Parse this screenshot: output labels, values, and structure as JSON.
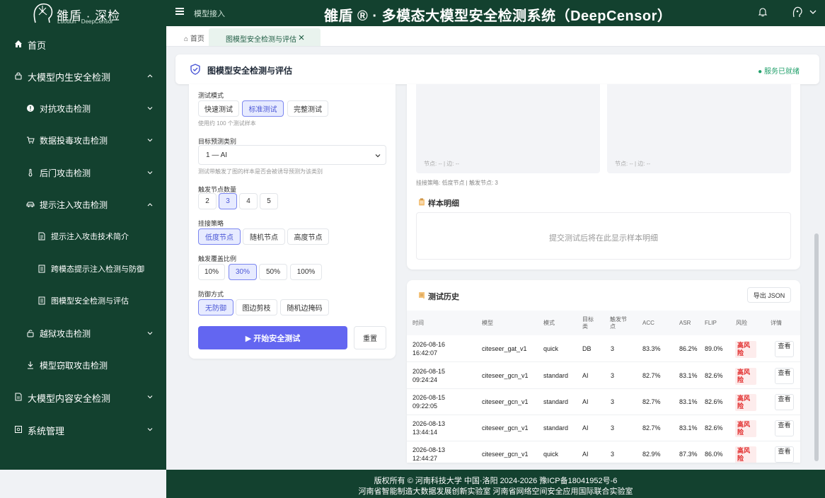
{
  "brand": {
    "name_cn": "雒盾 · 深检",
    "name_en": "Luodun · DeepCensor"
  },
  "topbar": {
    "breadcrumb": "模型接入",
    "system_title": "雒盾 ® · 多模态大模型安全检测系统（DeepCensor）"
  },
  "sidebar": {
    "items": [
      {
        "label": "首页"
      },
      {
        "label": "大模型内生安全检测"
      },
      {
        "label": "对抗攻击检测"
      },
      {
        "label": "数据投毒攻击检测"
      },
      {
        "label": "后门攻击检测"
      },
      {
        "label": "提示注入攻击检测"
      },
      {
        "label": "提示注入攻击技术简介"
      },
      {
        "label": "跨模态提示注入检测与防御"
      },
      {
        "label": "图模型安全检测与评估"
      },
      {
        "label": "越狱攻击检测"
      },
      {
        "label": "模型窃取攻击检测"
      },
      {
        "label": "大模型内容安全检测"
      },
      {
        "label": "系统管理"
      }
    ]
  },
  "tabs": {
    "home": "首页",
    "active": "图模型安全检测与评估"
  },
  "page": {
    "title": "图模型安全检测与评估",
    "status": "● 服务已就绪"
  },
  "config": {
    "mode_label": "测试模式",
    "modes": [
      "快速测试",
      "标准测试",
      "完整测试"
    ],
    "mode_hint": "使用约 100 个测试样本",
    "target_label": "目标预测类别",
    "target_value": "1 — AI",
    "target_hint": "测试带触发了图的样本是否会被诱导预测为该类别",
    "nodes_label": "触发节点数量",
    "nodes": [
      "2",
      "3",
      "4",
      "5"
    ],
    "strategy_label": "挂接策略",
    "strategies": [
      "低度节点",
      "随机节点",
      "高度节点"
    ],
    "coverage_label": "触发覆盖比例",
    "coverages": [
      "10%",
      "30%",
      "50%",
      "100%"
    ],
    "defense_label": "防御方式",
    "defenses": [
      "无防御",
      "图边剪枝",
      "随机边掩码"
    ],
    "start": "▶ 开始安全测试",
    "reset": "重置"
  },
  "viz": {
    "graph_left_stat": "节点: -- | 边: --",
    "graph_right_stat": "节点: -- | 边: --",
    "strategy_info": "挂接策略: 低度节点 | 触发节点: 3",
    "sample_title": "样本明细",
    "sample_empty": "提交测试后将在此显示样本明细"
  },
  "history": {
    "title": "测试历史",
    "export": "导出 JSON",
    "columns": [
      "时间",
      "模型",
      "模式",
      "目标类",
      "触发节点",
      "ACC",
      "ASR",
      "FLIP",
      "风险",
      "详情"
    ],
    "rows": [
      {
        "date": "2026-08-16",
        "time": "16:42:07",
        "model": "citeseer_gat_v1",
        "mode": "quick",
        "target": "DB",
        "nodes": "3",
        "acc": "83.3%",
        "asr": "86.2%",
        "flip": "89.0%",
        "risk": "高风险",
        "detail": "查看"
      },
      {
        "date": "2026-08-15",
        "time": "09:24:24",
        "model": "citeseer_gcn_v1",
        "mode": "standard",
        "target": "AI",
        "nodes": "3",
        "acc": "82.7%",
        "asr": "83.1%",
        "flip": "82.6%",
        "risk": "高风险",
        "detail": "查看"
      },
      {
        "date": "2026-08-15",
        "time": "09:22:05",
        "model": "citeseer_gcn_v1",
        "mode": "standard",
        "target": "AI",
        "nodes": "3",
        "acc": "82.7%",
        "asr": "83.1%",
        "flip": "82.6%",
        "risk": "高风险",
        "detail": "查看"
      },
      {
        "date": "2026-08-13",
        "time": "13:44:14",
        "model": "citeseer_gcn_v1",
        "mode": "standard",
        "target": "AI",
        "nodes": "3",
        "acc": "82.7%",
        "asr": "83.1%",
        "flip": "82.6%",
        "risk": "高风险",
        "detail": "查看"
      },
      {
        "date": "2026-08-13",
        "time": "12:44:27",
        "model": "citeseer_gcn_v1",
        "mode": "quick",
        "target": "AI",
        "nodes": "3",
        "acc": "82.9%",
        "asr": "87.3%",
        "flip": "86.0%",
        "risk": "高风险",
        "detail": "查看"
      }
    ]
  },
  "footer": {
    "line1": "版权所有 © 河南科技大学  中国·洛阳  2024-2026     豫ICP备18041952号-6",
    "line2": "河南省智能制造大数据发展创新实验室  河南省网络空间安全应用国际联合实验室"
  },
  "colors": {
    "sidebar_bg": "#13412f",
    "primary": "#6366f1",
    "risk_red": "#e02424",
    "ready_green": "#22a06b"
  }
}
